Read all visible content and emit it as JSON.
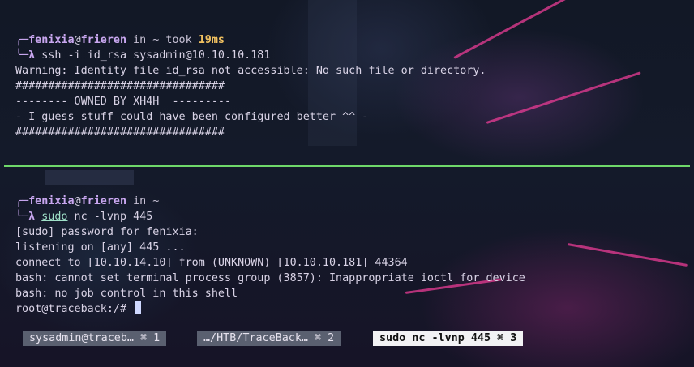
{
  "top_pane": {
    "prompt_user": "fenixia",
    "prompt_at": "@",
    "prompt_host": "frieren",
    "prompt_dir": " in ~",
    "took_label": " took ",
    "took_time": "19ms",
    "corner_top": "╭─",
    "corner_bottom": "╰─",
    "lambda": "λ",
    "command": " ssh -i id_rsa sysadmin@10.10.10.181",
    "output": [
      "Warning: Identity file id_rsa not accessible: No such file or directory.",
      "################################",
      "-------- OWNED BY XH4H  ---------",
      "- I guess stuff could have been configured better ^^ -",
      "################################"
    ]
  },
  "bottom_pane": {
    "prompt_user": "fenixia",
    "prompt_at": "@",
    "prompt_host": "frieren",
    "prompt_dir": " in ~",
    "corner_top": "╭─",
    "corner_bottom": "╰─",
    "lambda": "λ",
    "command_sudo": "sudo",
    "command_rest": " nc -lvnp 445",
    "output": [
      "[sudo] password for fenixia:",
      "listening on [any] 445 ...",
      "connect to [10.10.14.10] from (UNKNOWN) [10.10.10.181] 44364",
      "bash: cannot set terminal process group (3857): Inappropriate ioctl for device",
      "bash: no job control in this shell"
    ],
    "shell_prompt": "root@traceback:/# "
  },
  "tabs": [
    {
      "label": "sysadmin@traceb… ⌘ 1",
      "active": false
    },
    {
      "label": "…/HTB/TraceBack… ⌘ 2",
      "active": false
    },
    {
      "label": "sudo nc -lvnp 445 ⌘ 3",
      "active": true
    }
  ],
  "colors": {
    "divider": "#6fd86a",
    "prompt_accent": "#c9a7f0",
    "took_time": "#f0c060"
  }
}
